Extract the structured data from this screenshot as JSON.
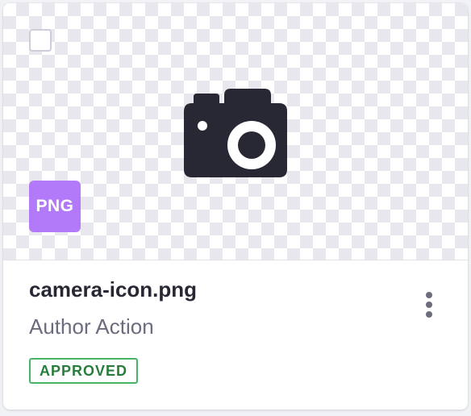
{
  "card": {
    "file_type": "PNG",
    "title": "camera-icon.png",
    "subtitle": "Author Action",
    "status": "APPROVED",
    "preview_icon": "camera-icon",
    "actions_icon": "vertical-ellipsis-icon",
    "selected": false
  },
  "colors": {
    "file_type_badge": "#b279f9",
    "camera_icon": "#272833",
    "status_border": "#48b566",
    "status_text": "#287d3c"
  }
}
